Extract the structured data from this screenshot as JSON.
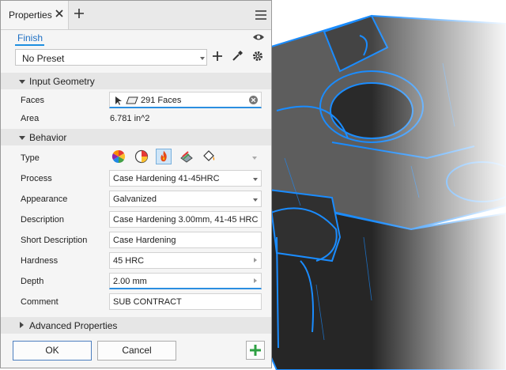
{
  "panel": {
    "tab_title": "Properties",
    "finish_label": "Finish",
    "preset_value": "No Preset",
    "sections": {
      "input_geometry": "Input Geometry",
      "behavior": "Behavior",
      "advanced": "Advanced Properties"
    },
    "faces": {
      "label": "Faces",
      "value": "291 Faces"
    },
    "area": {
      "label": "Area",
      "value": "6.781 in^2"
    },
    "type": {
      "label": "Type",
      "icons": [
        "color-wheel-icon",
        "appearance-icon",
        "flame-icon",
        "paint-icon",
        "bucket-icon"
      ]
    },
    "process": {
      "label": "Process",
      "value": "Case Hardening 41-45HRC"
    },
    "appearance": {
      "label": "Appearance",
      "value": "Galvanized"
    },
    "description": {
      "label": "Description",
      "value": "Case Hardening 3.00mm, 41-45 HRC"
    },
    "short_description": {
      "label": "Short Description",
      "value": "Case Hardening"
    },
    "hardness": {
      "label": "Hardness",
      "value": "45 HRC"
    },
    "depth": {
      "label": "Depth",
      "value": "2.00 mm"
    },
    "comment": {
      "label": "Comment",
      "value": "SUB CONTRACT"
    },
    "ok_label": "OK",
    "cancel_label": "Cancel"
  },
  "colors": {
    "accent": "#1d8fe0",
    "edge_highlight": "#1a8cff",
    "add_green": "#2ea043"
  }
}
